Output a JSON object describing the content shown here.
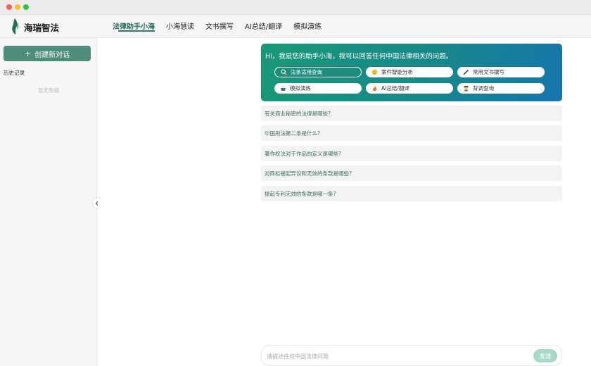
{
  "app": {
    "name": "海瑞智法",
    "brand_color": "#2a7e6a"
  },
  "nav": {
    "items": [
      {
        "label": "法律助手小海",
        "active": true
      },
      {
        "label": "小海慧读",
        "active": false
      },
      {
        "label": "文书撰写",
        "active": false
      },
      {
        "label": "AI总结/翻译",
        "active": false
      },
      {
        "label": "模拟演练",
        "active": false
      }
    ]
  },
  "sidebar": {
    "new_chat_icon": "+",
    "new_chat_label": "创建新对话",
    "history_label": "历史记录",
    "empty_label": "暂无数据",
    "collapse_icon": "chevron-left-icon"
  },
  "welcome": {
    "title": "Hi，我是您的助手小海，我可以回答任何中国法律相关的问题。",
    "chips": [
      {
        "label": "法条适用查询",
        "icon": "magnifier-icon",
        "active": true
      },
      {
        "label": "案件智能分析",
        "icon": "thinking-face-icon",
        "active": false
      },
      {
        "label": "常用文书撰写",
        "icon": "pen-icon",
        "active": false
      },
      {
        "label": "模拟演练",
        "icon": "pot-icon",
        "active": false
      },
      {
        "label": "AI总结/翻译",
        "icon": "fire-icon",
        "active": false
      },
      {
        "label": "背调查询",
        "icon": "detective-icon",
        "active": false
      }
    ]
  },
  "suggestions": [
    "有关商业秘密的法律是哪些?",
    "中国刑法第二条是什么?",
    "著作权法对于作品的定义是哪些?",
    "对商标提起异议和无效的条款是哪些?",
    "提起专利无效的条款是哪一条?"
  ],
  "input": {
    "placeholder": "请描述任何中国法律问题",
    "value": "",
    "send_label": "发送"
  }
}
